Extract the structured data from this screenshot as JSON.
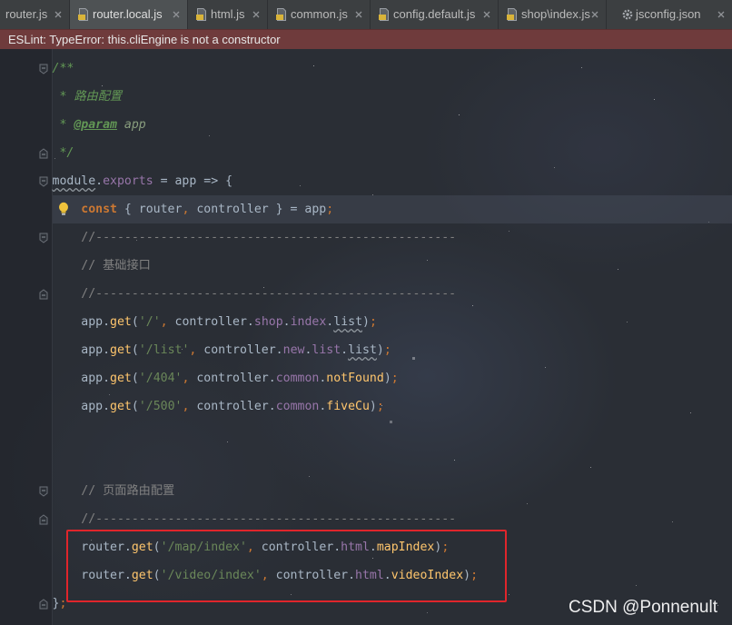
{
  "tabs": [
    {
      "label": "router.js",
      "icon": null,
      "active": false
    },
    {
      "label": "router.local.js",
      "icon": "js-file-icon",
      "active": true
    },
    {
      "label": "html.js",
      "icon": "js-file-icon",
      "active": false
    },
    {
      "label": "common.js",
      "icon": "js-file-icon",
      "active": false
    },
    {
      "label": "config.default.js",
      "icon": "js-file-icon",
      "active": false
    },
    {
      "label": "shop\\index.js",
      "icon": "js-file-icon",
      "active": false
    },
    {
      "label": "jsconfig.json",
      "icon": "json-config-icon",
      "active": false
    }
  ],
  "error_banner": {
    "text": "ESLint: TypeError: this.cliEngine is not a constructor"
  },
  "editor": {
    "lines": [
      {
        "fold": "start",
        "tokens": [
          {
            "kind": "doc",
            "text": "/**"
          }
        ]
      },
      {
        "tokens": [
          {
            "kind": "doc",
            "text": " * 路由配置"
          }
        ]
      },
      {
        "tokens": [
          {
            "kind": "doc",
            "text": " * "
          },
          {
            "kind": "doctag",
            "text": "@param"
          },
          {
            "kind": "docvalue",
            "text": " app"
          }
        ]
      },
      {
        "fold": "end",
        "tokens": [
          {
            "kind": "doc",
            "text": " */"
          }
        ]
      },
      {
        "fold": "start",
        "tokens": [
          {
            "kind": "warn",
            "text": "module"
          },
          {
            "kind": "text",
            "text": "."
          },
          {
            "kind": "property",
            "text": "exports"
          },
          {
            "kind": "text",
            "text": " = app => {"
          }
        ]
      },
      {
        "current": true,
        "gutter_icon": "lightbulb-icon",
        "tokens": [
          {
            "kind": "text",
            "text": "    "
          },
          {
            "kind": "keyword",
            "text": "const"
          },
          {
            "kind": "text",
            "text": " { router"
          },
          {
            "kind": "punct",
            "text": ","
          },
          {
            "kind": "text",
            "text": " controller } = app"
          },
          {
            "kind": "punct",
            "text": ";"
          }
        ]
      },
      {
        "fold": "start",
        "tokens": [
          {
            "kind": "comment",
            "text": "    //--------------------------------------------------"
          }
        ]
      },
      {
        "tokens": [
          {
            "kind": "comment",
            "text": "    // 基础接口"
          }
        ]
      },
      {
        "fold": "end",
        "tokens": [
          {
            "kind": "comment",
            "text": "    //--------------------------------------------------"
          }
        ]
      },
      {
        "tokens": [
          {
            "kind": "text",
            "text": "    app."
          },
          {
            "kind": "function",
            "text": "get"
          },
          {
            "kind": "text",
            "text": "("
          },
          {
            "kind": "string",
            "text": "'/'"
          },
          {
            "kind": "punct",
            "text": ","
          },
          {
            "kind": "text",
            "text": " controller."
          },
          {
            "kind": "property",
            "text": "shop"
          },
          {
            "kind": "text",
            "text": "."
          },
          {
            "kind": "property",
            "text": "index"
          },
          {
            "kind": "text",
            "text": "."
          },
          {
            "kind": "warn",
            "text": "list"
          },
          {
            "kind": "text",
            "text": ")"
          },
          {
            "kind": "punct",
            "text": ";"
          }
        ]
      },
      {
        "tokens": [
          {
            "kind": "text",
            "text": "    app."
          },
          {
            "kind": "function",
            "text": "get"
          },
          {
            "kind": "text",
            "text": "("
          },
          {
            "kind": "string",
            "text": "'/list'"
          },
          {
            "kind": "punct",
            "text": ","
          },
          {
            "kind": "text",
            "text": " controller."
          },
          {
            "kind": "property",
            "text": "new"
          },
          {
            "kind": "text",
            "text": "."
          },
          {
            "kind": "property",
            "text": "list"
          },
          {
            "kind": "text",
            "text": "."
          },
          {
            "kind": "warn",
            "text": "list"
          },
          {
            "kind": "text",
            "text": ")"
          },
          {
            "kind": "punct",
            "text": ";"
          }
        ]
      },
      {
        "tokens": [
          {
            "kind": "text",
            "text": "    app."
          },
          {
            "kind": "function",
            "text": "get"
          },
          {
            "kind": "text",
            "text": "("
          },
          {
            "kind": "string",
            "text": "'/404'"
          },
          {
            "kind": "punct",
            "text": ","
          },
          {
            "kind": "text",
            "text": " controller."
          },
          {
            "kind": "property",
            "text": "common"
          },
          {
            "kind": "text",
            "text": "."
          },
          {
            "kind": "function",
            "text": "notFound"
          },
          {
            "kind": "text",
            "text": ")"
          },
          {
            "kind": "punct",
            "text": ";"
          }
        ]
      },
      {
        "tokens": [
          {
            "kind": "text",
            "text": "    app."
          },
          {
            "kind": "function",
            "text": "get"
          },
          {
            "kind": "text",
            "text": "("
          },
          {
            "kind": "string",
            "text": "'/500'"
          },
          {
            "kind": "punct",
            "text": ","
          },
          {
            "kind": "text",
            "text": " controller."
          },
          {
            "kind": "property",
            "text": "common"
          },
          {
            "kind": "text",
            "text": "."
          },
          {
            "kind": "function",
            "text": "fiveCu"
          },
          {
            "kind": "text",
            "text": ")"
          },
          {
            "kind": "punct",
            "text": ";"
          }
        ]
      },
      {
        "tokens": []
      },
      {
        "tokens": []
      },
      {
        "fold": "start",
        "tokens": [
          {
            "kind": "comment",
            "text": "    // 页面路由配置"
          }
        ]
      },
      {
        "fold": "end",
        "tokens": [
          {
            "kind": "comment",
            "text": "    //--------------------------------------------------"
          }
        ]
      },
      {
        "tokens": [
          {
            "kind": "text",
            "text": "    router."
          },
          {
            "kind": "function",
            "text": "get"
          },
          {
            "kind": "text",
            "text": "("
          },
          {
            "kind": "string",
            "text": "'/map/index'"
          },
          {
            "kind": "punct",
            "text": ","
          },
          {
            "kind": "text",
            "text": " controller."
          },
          {
            "kind": "property",
            "text": "html"
          },
          {
            "kind": "text",
            "text": "."
          },
          {
            "kind": "function",
            "text": "mapIndex"
          },
          {
            "kind": "text",
            "text": ")"
          },
          {
            "kind": "punct",
            "text": ";"
          }
        ]
      },
      {
        "tokens": [
          {
            "kind": "text",
            "text": "    router."
          },
          {
            "kind": "function",
            "text": "get"
          },
          {
            "kind": "text",
            "text": "("
          },
          {
            "kind": "string",
            "text": "'/video/index'"
          },
          {
            "kind": "punct",
            "text": ","
          },
          {
            "kind": "text",
            "text": " controller."
          },
          {
            "kind": "property",
            "text": "html"
          },
          {
            "kind": "text",
            "text": "."
          },
          {
            "kind": "function",
            "text": "videoIndex"
          },
          {
            "kind": "text",
            "text": ")"
          },
          {
            "kind": "punct",
            "text": ";"
          }
        ]
      },
      {
        "fold": "end",
        "tokens": [
          {
            "kind": "text",
            "text": "}"
          },
          {
            "kind": "punct",
            "text": ";"
          }
        ]
      }
    ]
  },
  "watermark": "CSDN @Ponnenult",
  "colors": {
    "error_banner_bg": "#6f3b3c",
    "annotation_box": "#e0252b",
    "text": "#a9b7c6",
    "keyword": "#cc7832",
    "string": "#6a8759",
    "property": "#9876aa",
    "function": "#ffc66d",
    "comment": "#808080",
    "doc_comment": "#629755"
  }
}
